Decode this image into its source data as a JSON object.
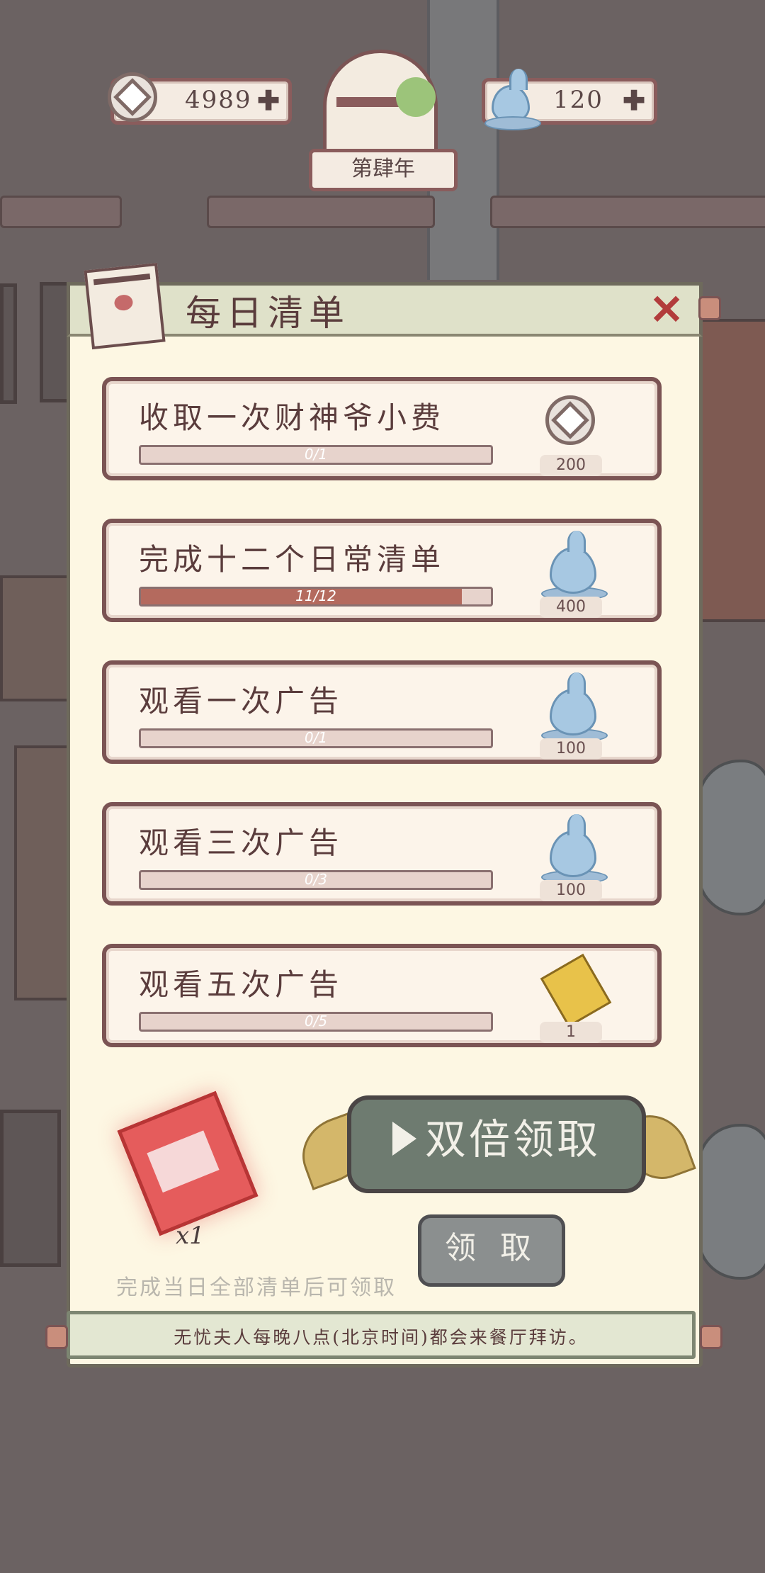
{
  "hud": {
    "coins": "4989",
    "water": "120",
    "year": "第肆年"
  },
  "panel": {
    "title": "每日清单"
  },
  "tasks": [
    {
      "label": "收取一次财神爷小费",
      "progress_text": "0/1",
      "progress": 0.0,
      "reward_icon": "coin-icon",
      "reward_amount": "200"
    },
    {
      "label": "完成十二个日常清单",
      "progress_text": "11/12",
      "progress": 0.9167,
      "reward_icon": "water-drop-icon",
      "reward_amount": "400"
    },
    {
      "label": "观看一次广告",
      "progress_text": "0/1",
      "progress": 0.0,
      "reward_icon": "water-drop-icon",
      "reward_amount": "100"
    },
    {
      "label": "观看三次广告",
      "progress_text": "0/3",
      "progress": 0.0,
      "reward_icon": "water-drop-icon",
      "reward_amount": "100"
    },
    {
      "label": "观看五次广告",
      "progress_text": "0/5",
      "progress": 0.0,
      "reward_icon": "ticket-icon",
      "reward_amount": "1"
    }
  ],
  "bottom": {
    "coupon_count": "x1",
    "double_claim_label": "双倍领取",
    "claim_label": "领 取",
    "hint": "完成当日全部清单后可领取",
    "footer": "无忧夫人每晚八点(北京时间)都会来餐厅拜访。"
  },
  "colors": {
    "progress_fill": "#b46a5e",
    "panel_bg": "#fdf7e3",
    "accent_red": "#b23c3c"
  }
}
